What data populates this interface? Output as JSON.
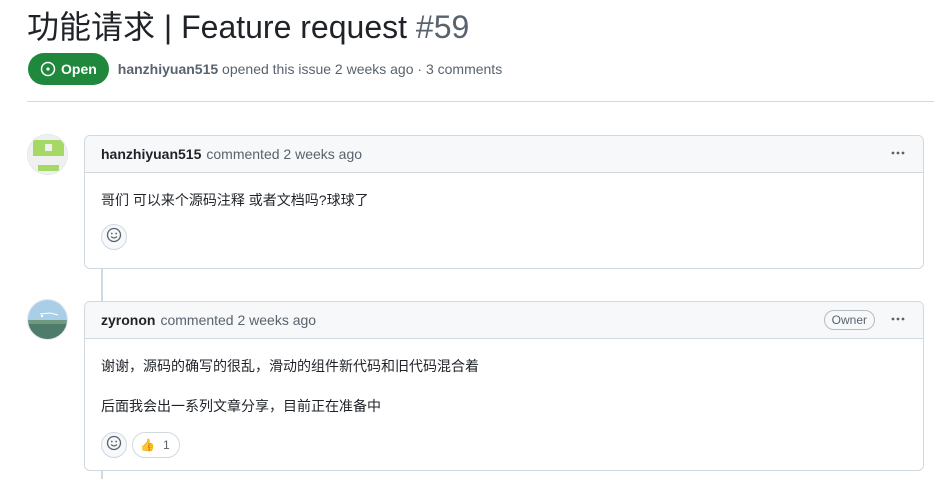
{
  "issue": {
    "title": "功能请求 | Feature request",
    "number": "#59",
    "state": "Open",
    "author": "hanzhiyuan515",
    "meta_text": "opened this issue 2 weeks ago · 3 comments"
  },
  "comments": [
    {
      "author": "hanzhiyuan515",
      "action": "commented 2 weeks ago",
      "body": [
        "哥们 可以来个源码注释 或者文档吗?球球了"
      ],
      "avatar_icon": "identicon-avatar"
    },
    {
      "author": "zyronon",
      "action": "commented 2 weeks ago",
      "badge": "Owner",
      "body": [
        "谢谢，源码的确写的很乱，滑动的组件新代码和旧代码混合着",
        "后面我会出一系列文章分享，目前正在准备中"
      ],
      "reaction": {
        "icon": "thumbs-up-icon",
        "glyph": "👍",
        "count": "1"
      },
      "avatar_icon": "landscape-photo-avatar"
    }
  ],
  "colors": {
    "open_green": "#1f883d",
    "border": "#d1d9e0",
    "header_bg": "#f6f8fa",
    "muted_text": "#59636e"
  }
}
